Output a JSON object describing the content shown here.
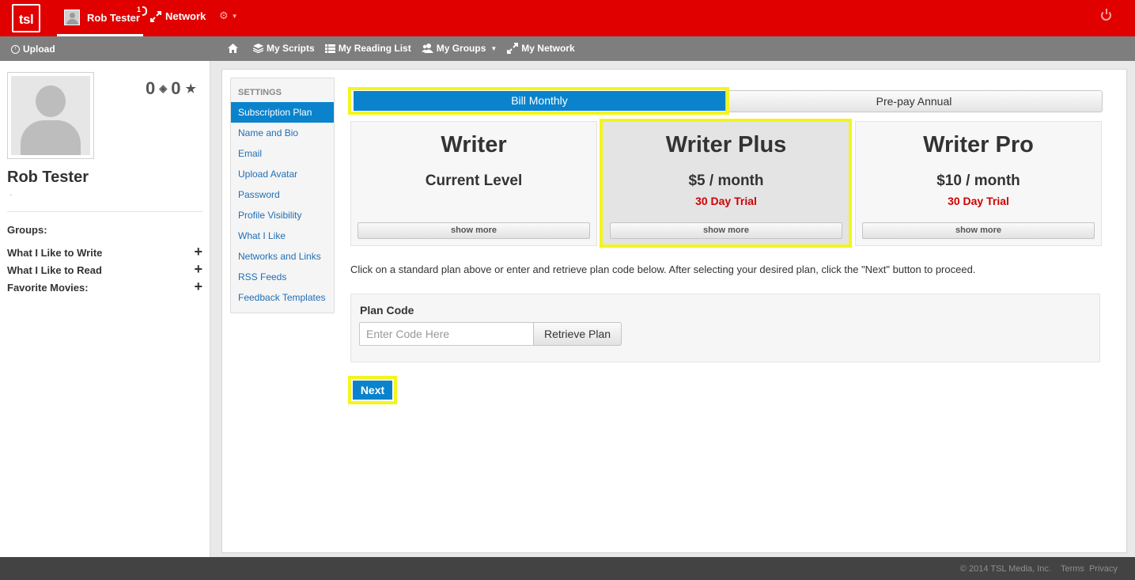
{
  "topbar": {
    "logo": "tsl",
    "user_name": "Rob Tester",
    "notification_count": "1",
    "network_label": "Network",
    "gear_glyph": "⚙",
    "icons": [
      "logo",
      "avatar-icon",
      "network-icon",
      "gear-icon",
      "power-icon"
    ],
    "accent_color": "#e00000"
  },
  "subbar": {
    "upload_label": "Upload",
    "nav": [
      {
        "icon": "home-icon",
        "label": ""
      },
      {
        "icon": "layers-icon",
        "label": "My Scripts"
      },
      {
        "icon": "list-icon",
        "label": "My Reading List"
      },
      {
        "icon": "group-icon",
        "label": "My Groups"
      },
      {
        "icon": "network-icon",
        "label": "My Network"
      }
    ]
  },
  "profile": {
    "stat_views": "0",
    "stat_stars": "0",
    "name": "Rob Tester",
    "subtitle": "·",
    "groups_title": "Groups:",
    "groups": [
      {
        "label": "What I Like to Write"
      },
      {
        "label": "What I Like to Read"
      },
      {
        "label": "Favorite Movies:"
      }
    ]
  },
  "settings": {
    "heading": "SETTINGS",
    "items": [
      {
        "label": "Subscription Plan",
        "active": true
      },
      {
        "label": "Name and Bio"
      },
      {
        "label": "Email"
      },
      {
        "label": "Upload Avatar"
      },
      {
        "label": "Password"
      },
      {
        "label": "Profile Visibility"
      },
      {
        "label": "What I Like"
      },
      {
        "label": "Networks and Links"
      },
      {
        "label": "RSS Feeds"
      },
      {
        "label": "Feedback Templates"
      }
    ]
  },
  "billing": {
    "monthly_label": "Bill Monthly",
    "annual_label": "Pre-pay Annual",
    "selected": "Bill Monthly",
    "active_color": "#0a83cc"
  },
  "plans": [
    {
      "name": "Writer",
      "price": "Current Level",
      "trial": "",
      "show_more": "show more"
    },
    {
      "name": "Writer Plus",
      "price": "$5 / month",
      "trial": "30 Day Trial",
      "show_more": "show more",
      "selected": true
    },
    {
      "name": "Writer Pro",
      "price": "$10 / month",
      "trial": "30 Day Trial",
      "show_more": "show more"
    }
  ],
  "instructions": "Click on a standard plan above or enter and retrieve plan code below. After selecting your desired plan, click the \"Next\" button to proceed.",
  "plan_code": {
    "label": "Plan Code",
    "placeholder": "Enter Code Here",
    "value": "",
    "retrieve_label": "Retrieve Plan"
  },
  "next_label": "Next",
  "footer": {
    "copyright": "© 2014 TSL Media, Inc.",
    "terms": "Terms",
    "privacy": "Privacy"
  }
}
